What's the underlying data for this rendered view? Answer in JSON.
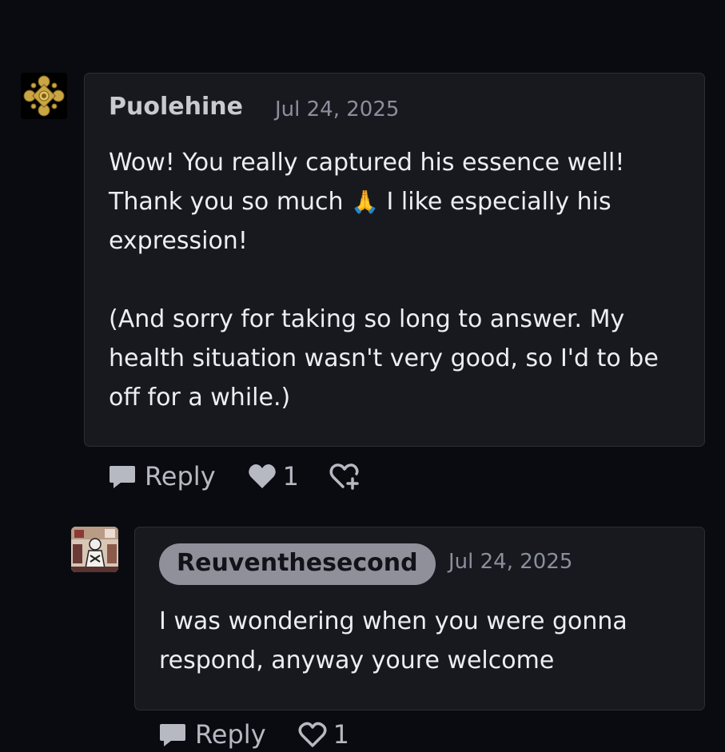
{
  "comments": [
    {
      "author": "Puolehine",
      "date": "Jul 24, 2025",
      "body_line1_before_emoji": "Wow! You really captured his essence well! Thank you so much ",
      "emoji": "🙏",
      "body_line1_after_emoji": " I like especially his expression!",
      "body_para2": "(And sorry for taking so long to answer. My health situation wasn't very good, so I'd to be off for a while.)",
      "reply_label": "Reply",
      "like_count": "1"
    },
    {
      "author": "Reuventhesecond",
      "date": "Jul 24, 2025",
      "body": "I was wondering when you were gonna respond, anyway youre welcome",
      "reply_label": "Reply",
      "like_count": "1"
    }
  ],
  "colors": {
    "background": "#090b10",
    "card": "#17191e",
    "author_pill": "#8f909a",
    "muted_text": "#8b8f9c"
  },
  "icons": [
    "speech-bubble-icon",
    "heart-icon",
    "heart-plus-icon",
    "ornament-avatar-icon"
  ]
}
